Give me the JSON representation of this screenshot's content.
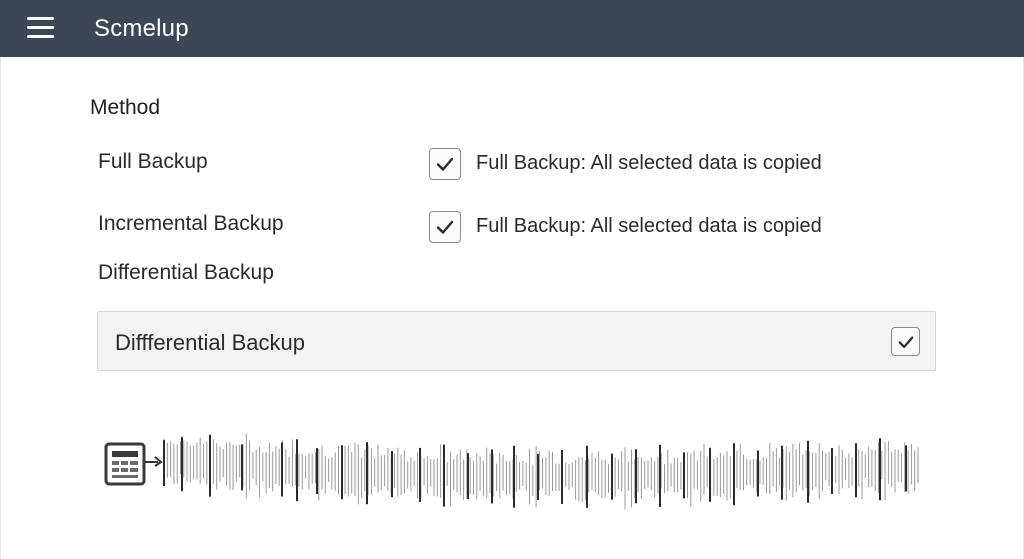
{
  "header": {
    "title": "Scmelup",
    "menu_icon": "hamburger-menu-icon"
  },
  "section": {
    "title": "Method"
  },
  "methods": [
    {
      "label": "Full Backup",
      "description": "Full Backup: All selected data is copied",
      "checked": true
    },
    {
      "label": "Incremental Backup",
      "description": "Full Backup: All selected data is copied",
      "checked": true
    },
    {
      "label": "Differential Backup"
    }
  ],
  "selector": {
    "value": "Diffferential Backup",
    "checked": true
  },
  "timeline": {
    "source_icon": "spreadsheet-document-icon",
    "arrow_icon": "arrow-right-icon",
    "waveform_icon": "backup-activity-waveform"
  },
  "colors": {
    "header_bg": "#3d4655",
    "header_text": "#ffffff",
    "select_bg": "#f3f3f3"
  }
}
